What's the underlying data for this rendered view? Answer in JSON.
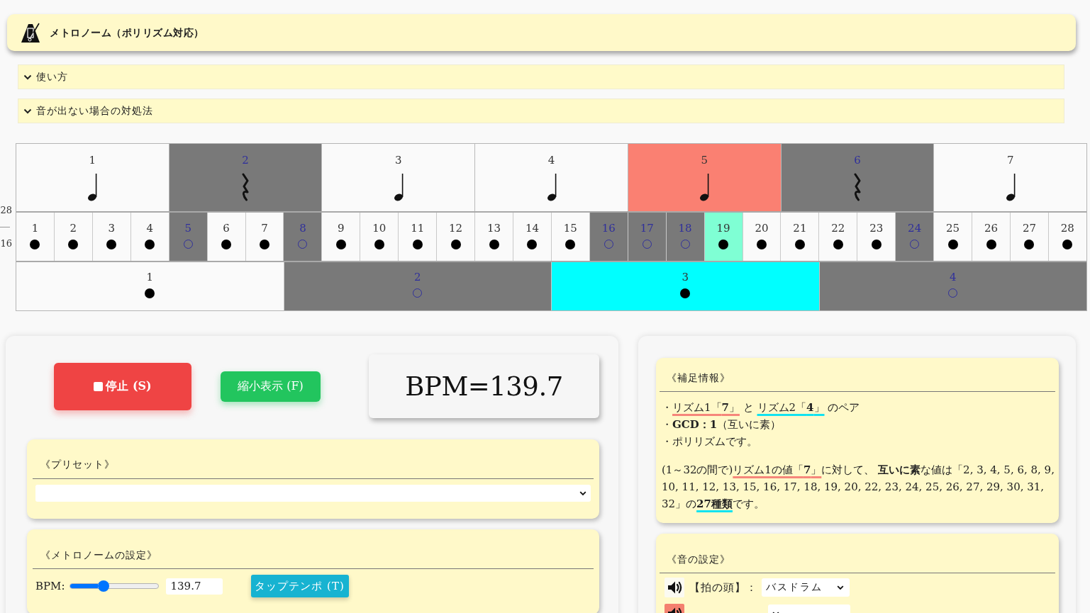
{
  "header": {
    "title": "メトロノーム（ポリリズム対応）"
  },
  "accordions": [
    {
      "label": "使い方",
      "expanded": false
    },
    {
      "label": "音が出ない場合の対処法",
      "expanded": false
    }
  ],
  "grid": {
    "ratio_labels": [
      "28",
      "16"
    ],
    "rhythm1_beats": [
      {
        "label": "1",
        "kind": "note",
        "active": false
      },
      {
        "label": "2",
        "kind": "rest",
        "active": false
      },
      {
        "label": "3",
        "kind": "note",
        "active": false
      },
      {
        "label": "4",
        "kind": "note",
        "active": false
      },
      {
        "label": "5",
        "kind": "note",
        "active": true
      },
      {
        "label": "6",
        "kind": "rest",
        "active": false
      },
      {
        "label": "7",
        "kind": "note",
        "active": false
      }
    ],
    "steps": [
      {
        "label": "1",
        "muted": false,
        "active": false
      },
      {
        "label": "2",
        "muted": false,
        "active": false
      },
      {
        "label": "3",
        "muted": false,
        "active": false
      },
      {
        "label": "4",
        "muted": false,
        "active": false
      },
      {
        "label": "5",
        "muted": true,
        "active": false
      },
      {
        "label": "6",
        "muted": false,
        "active": false
      },
      {
        "label": "7",
        "muted": false,
        "active": false
      },
      {
        "label": "8",
        "muted": true,
        "active": false
      },
      {
        "label": "9",
        "muted": false,
        "active": false
      },
      {
        "label": "10",
        "muted": false,
        "active": false
      },
      {
        "label": "11",
        "muted": false,
        "active": false
      },
      {
        "label": "12",
        "muted": false,
        "active": false
      },
      {
        "label": "13",
        "muted": false,
        "active": false
      },
      {
        "label": "14",
        "muted": false,
        "active": false
      },
      {
        "label": "15",
        "muted": false,
        "active": false
      },
      {
        "label": "16",
        "muted": true,
        "active": false
      },
      {
        "label": "17",
        "muted": true,
        "active": false
      },
      {
        "label": "18",
        "muted": true,
        "active": false
      },
      {
        "label": "19",
        "muted": false,
        "active": true
      },
      {
        "label": "20",
        "muted": false,
        "active": false
      },
      {
        "label": "21",
        "muted": false,
        "active": false
      },
      {
        "label": "22",
        "muted": false,
        "active": false
      },
      {
        "label": "23",
        "muted": false,
        "active": false
      },
      {
        "label": "24",
        "muted": true,
        "active": false
      },
      {
        "label": "25",
        "muted": false,
        "active": false
      },
      {
        "label": "26",
        "muted": false,
        "active": false
      },
      {
        "label": "27",
        "muted": false,
        "active": false
      },
      {
        "label": "28",
        "muted": false,
        "active": false
      }
    ],
    "rhythm2_beats": [
      {
        "label": "1",
        "muted": false,
        "active": false
      },
      {
        "label": "2",
        "muted": true,
        "active": false
      },
      {
        "label": "3",
        "muted": false,
        "active": true
      },
      {
        "label": "4",
        "muted": true,
        "active": false
      }
    ]
  },
  "transport": {
    "stop_button": "停止 (S)",
    "compact_button": "縮小表示 (F)",
    "bpm_display": "BPM=139.7"
  },
  "preset": {
    "title": "《プリセット》"
  },
  "metronome_settings": {
    "title": "《メトロノームの設定》",
    "bpm_label": "BPM:",
    "bpm_slider": {
      "level": 0.37
    },
    "bpm_input": "139.7",
    "tap_button": "タップテンポ (T)"
  },
  "info": {
    "title": "《補足情報》",
    "lines": [
      [
        {
          "text": "・"
        },
        {
          "text": "リズム1「**7**」",
          "kind": "rhythm1"
        },
        {
          "text": " と "
        },
        {
          "text": "リズム2「**4**」",
          "kind": "rhythm2"
        },
        {
          "text": " のペア"
        }
      ],
      [
        {
          "text": "・**GCD：1**（互いに素）"
        }
      ],
      [
        {
          "text": "・ポリリズムです。"
        }
      ]
    ],
    "note": [
      {
        "text": "(1～32の間で)"
      },
      {
        "text": "リズム1の値「**7**」",
        "kind": "rhythm1"
      },
      {
        "text": "に対して、 **互いに素**な値は「2, 3, 4, 5, 6, 8, 9, 10, 11, 12, 13, 15, 16, 17, 18, 19, 20, 22, 23, 24, 25, 26, 27, 29, 30, 31, 32」の"
      },
      {
        "text": "**27種類**",
        "kind": "rhythm2"
      },
      {
        "text": "です。"
      }
    ]
  },
  "sound_settings": {
    "title": "《音の設定》",
    "rows": [
      {
        "kind": "beat-head",
        "label": "【拍の頭】：",
        "value": "バスドラム"
      },
      {
        "kind": "rhythm1"
      }
    ]
  }
}
